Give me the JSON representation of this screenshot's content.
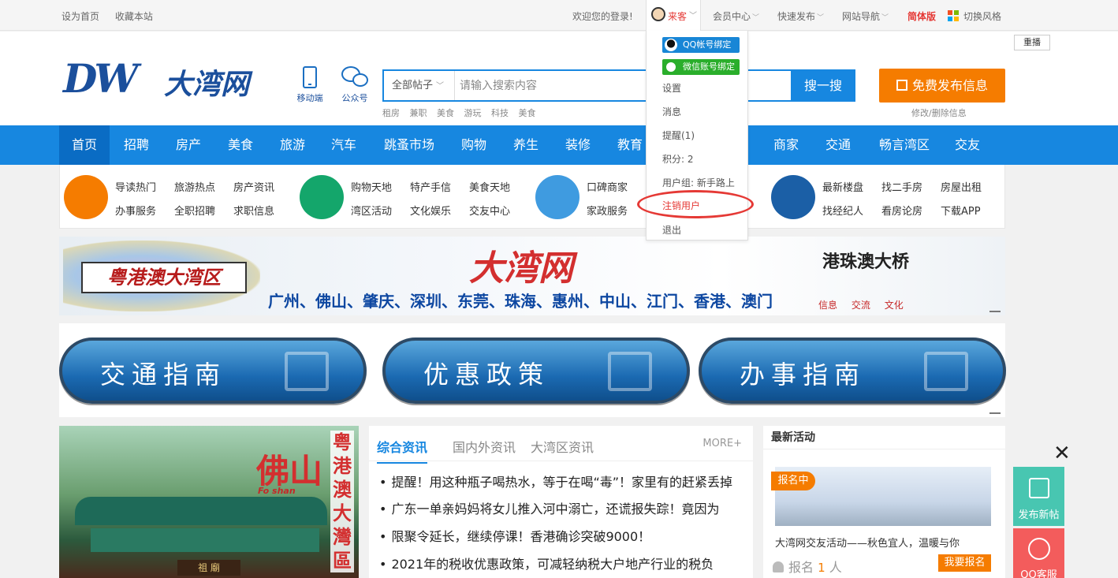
{
  "topbar": {
    "set_home": "设为首页",
    "bookmark": "收藏本站",
    "welcome": "欢迎您的登录!",
    "user_name": "来客",
    "member_center": "会员中心",
    "quick_publish": "快速发布",
    "site_nav": "网站导航",
    "simplified": "简体版",
    "switch_style": "切换风格"
  },
  "header": {
    "logo_text": "DW",
    "logo_cn": "大湾网",
    "mobile": "移动端",
    "wechat": "公众号",
    "search_category": "全部帖子",
    "search_placeholder": "请输入搜索内容",
    "search_button": "搜一搜",
    "hot_words": [
      "租房",
      "兼职",
      "美食",
      "游玩",
      "科技",
      "美食"
    ],
    "publish_button": "免费发布信息",
    "modify_link": "修改/删除信息",
    "replay": "重播"
  },
  "nav": {
    "items": [
      "首页",
      "招聘",
      "房产",
      "美食",
      "旅游",
      "汽车",
      "跳蚤市场",
      "购物",
      "养生",
      "装修",
      "教育",
      "商家",
      "交通",
      "畅言湾区",
      "交友"
    ]
  },
  "quick": {
    "g1": [
      "导读热门",
      "旅游热点",
      "房产资讯",
      "办事服务",
      "全职招聘",
      "求职信息"
    ],
    "g2": [
      "购物天地",
      "特产手信",
      "美食天地",
      "湾区活动",
      "文化娱乐",
      "交友中心"
    ],
    "g3": [
      "口碑商家",
      "家政服务"
    ],
    "g4": [
      "最新楼盘",
      "找二手房",
      "房屋出租",
      "找经纪人",
      "看房论房",
      "下载APP"
    ]
  },
  "banner": {
    "gba": "粤港澳大湾区",
    "title": "大湾网",
    "cities": "广州、佛山、肇庆、深圳、东莞、珠海、惠州、中山、江门、香港、澳门",
    "hzm": "港珠澳大桥",
    "tags": [
      "信息",
      "交流",
      "文化"
    ]
  },
  "guides": [
    "交通指南",
    "优惠政策",
    "办事指南"
  ],
  "foshan": {
    "title": "佛山",
    "en": "Fo shan",
    "side": "粤港澳大灣區",
    "plaque": "祖 廟"
  },
  "news": {
    "tabs": [
      "综合资讯",
      "国内外资讯",
      "大湾区资讯"
    ],
    "more": "MORE+",
    "items": [
      "提醒！用这种瓶子喝热水，等于在喝“毒”！家里有的赶紧丢掉",
      "广东一单亲妈妈将女儿推入河中溺亡，还谎报失踪！竟因为",
      "限聚令延长，继续停课！香港确诊突破9000！",
      "2021年的税收优惠政策，可减轻纳税大户地产行业的税负"
    ]
  },
  "activity": {
    "header": "最新活动",
    "badge": "报名中",
    "desc": "大湾网交友活动——秋色宜人，温暖与你",
    "count_prefix": "报名",
    "count": "1",
    "count_suffix": "人",
    "join": "我要报名"
  },
  "float": {
    "close": "✕",
    "post": "发布新帖",
    "qq": "QQ客服"
  },
  "dropdown": {
    "qq_bind": "QQ帐号绑定",
    "wx_bind": "微信账号绑定",
    "settings": "设置",
    "messages": "消息",
    "reminders": "提醒(1)",
    "points": "积分: 2",
    "user_group": "用户组: 新手路上",
    "cancel_user": "注销用户",
    "logout": "退出"
  },
  "colors": {
    "primary": "#1787e0",
    "accent": "#f57c00",
    "alert": "#e53935"
  }
}
